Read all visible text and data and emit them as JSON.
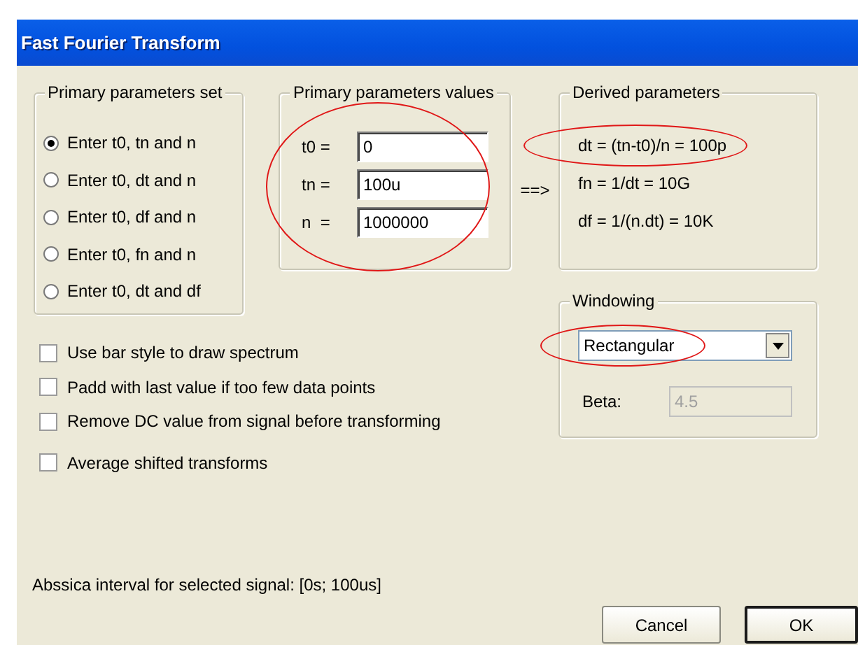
{
  "window": {
    "title": "Fast Fourier Transform"
  },
  "primary_set": {
    "title": "Primary parameters set",
    "options": [
      {
        "label": "Enter t0, tn and n",
        "selected": true
      },
      {
        "label": "Enter t0, dt and n",
        "selected": false
      },
      {
        "label": "Enter t0, df and n",
        "selected": false
      },
      {
        "label": "Enter t0, fn and n",
        "selected": false
      },
      {
        "label": "Enter t0, dt and df",
        "selected": false
      }
    ]
  },
  "values": {
    "title": "Primary parameters values",
    "highlighted": true,
    "fields": [
      {
        "label": "t0 =",
        "value": "0"
      },
      {
        "label": "tn =",
        "value": "100u"
      },
      {
        "label": "n  =",
        "value": "1000000"
      }
    ]
  },
  "arrow": "==>",
  "derived": {
    "title": "Derived parameters",
    "lines": [
      {
        "text": "dt = (tn-t0)/n = 100p",
        "highlighted": true
      },
      {
        "text": "fn = 1/dt = 10G"
      },
      {
        "text": "df = 1/(n.dt) = 10K"
      }
    ]
  },
  "windowing": {
    "title": "Windowing",
    "dropdown": {
      "value": "Rectangular",
      "highlighted": true
    },
    "beta": {
      "label": "Beta:",
      "value": "4.5",
      "disabled": true
    }
  },
  "options": [
    {
      "label": "Use bar style to draw spectrum",
      "checked": false
    },
    {
      "label": "Padd with last value if too few data points",
      "checked": false
    },
    {
      "label": "Remove DC value from signal before transforming",
      "checked": false
    },
    {
      "label": "Average shifted transforms",
      "checked": false
    }
  ],
  "status": "Abssica interval for selected signal: [0s; 100us]",
  "buttons": [
    {
      "label": "Cancel",
      "default": false
    },
    {
      "label": "OK",
      "default": true
    }
  ]
}
